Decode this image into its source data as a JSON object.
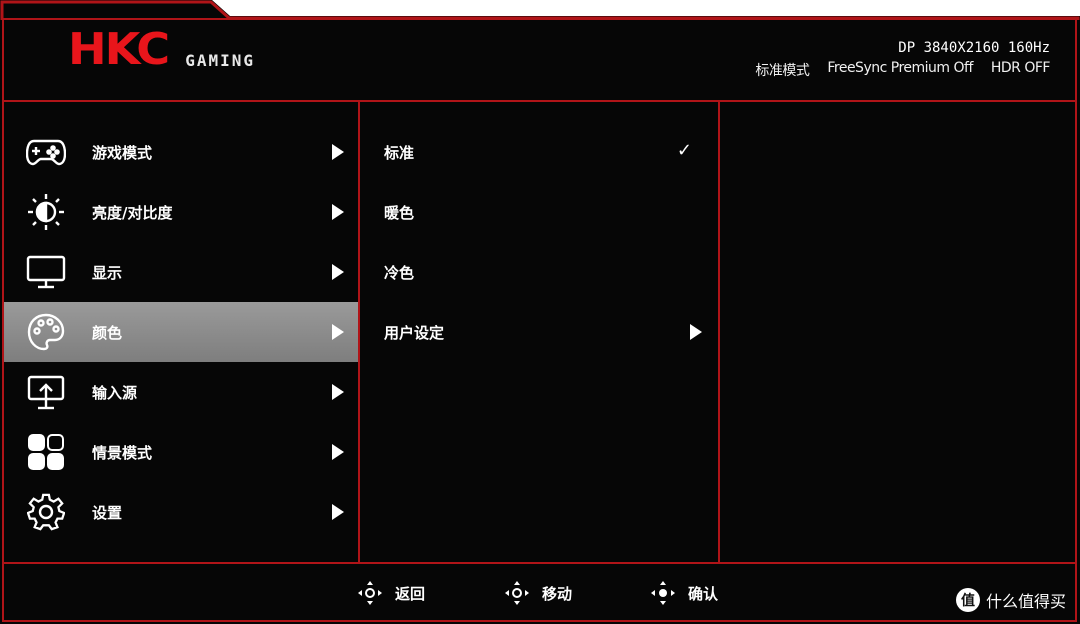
{
  "brand": {
    "logo_text": "HKC",
    "subtitle": "GAMING"
  },
  "status": {
    "line1": "DP 3840X2160 160Hz",
    "mode": "标准模式",
    "freesync": "FreeSync Premium Off",
    "hdr": "HDR OFF"
  },
  "menu": {
    "items": [
      {
        "label": "游戏模式",
        "icon": "gamepad-icon"
      },
      {
        "label": "亮度/对比度",
        "icon": "brightness-icon"
      },
      {
        "label": "显示",
        "icon": "monitor-icon"
      },
      {
        "label": "颜色",
        "icon": "palette-icon",
        "active": true
      },
      {
        "label": "输入源",
        "icon": "input-source-icon"
      },
      {
        "label": "情景模式",
        "icon": "scene-mode-icon"
      },
      {
        "label": "设置",
        "icon": "gear-icon"
      }
    ]
  },
  "submenu": {
    "items": [
      {
        "label": "标准",
        "selected": true,
        "check": "✓"
      },
      {
        "label": "暖色"
      },
      {
        "label": "冷色"
      },
      {
        "label": "用户设定",
        "has_submenu": true
      }
    ]
  },
  "footer": {
    "back": "返回",
    "move": "移动",
    "confirm": "确认"
  },
  "watermark": {
    "logo": "值",
    "text": "什么值得买"
  },
  "colors": {
    "frame": "#b01418",
    "brand_red": "#e8151b",
    "active_bg": "#8c8c8c",
    "background": "#060606"
  }
}
